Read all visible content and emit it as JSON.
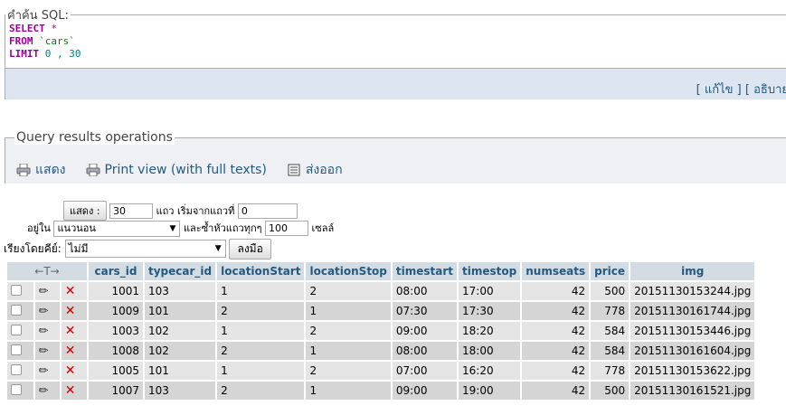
{
  "sql_section": {
    "legend": "คำค้น SQL:",
    "line1_kw": "SELECT",
    "line1_rest": " *",
    "line2_kw": "FROM",
    "line2_str": " `cars`",
    "line3_kw": "LIMIT",
    "line3_num": " 0 , 30",
    "link_edit": "แก้ไข",
    "link_explain": "อธิบาย"
  },
  "qro": {
    "legend": "Query results operations",
    "print": "แสดง",
    "print_full": "Print view (with full texts)",
    "export": "ส่งออก"
  },
  "navigation": {
    "show_button": "แสดง :",
    "rows_value": "30",
    "rows_label": "แถว เริ่มจากแถวที่",
    "start_value": "0",
    "mode_label": "อยู่ใน",
    "mode_value": "แนวนอน",
    "repeat_label": "และซ้ำหัวแถวทุกๆ",
    "repeat_value": "100",
    "cells_label": "เซลล์",
    "sort_label": "เรียงโดยคีย์:",
    "sort_value": "ไม่มี",
    "go_button": "ลงมือ"
  },
  "table": {
    "arrows": "←T→",
    "columns": [
      "cars_id",
      "typecar_id",
      "locationStart",
      "locationStop",
      "timestart",
      "timestop",
      "numseats",
      "price",
      "img"
    ],
    "rows": [
      [
        "1001",
        "103",
        "1",
        "2",
        "08:00",
        "17:00",
        "42",
        "500",
        "20151130153244.jpg"
      ],
      [
        "1009",
        "101",
        "2",
        "1",
        "07:30",
        "17:30",
        "42",
        "778",
        "20151130161744.jpg"
      ],
      [
        "1003",
        "102",
        "1",
        "2",
        "09:00",
        "18:20",
        "42",
        "584",
        "20151130153446.jpg"
      ],
      [
        "1008",
        "102",
        "2",
        "1",
        "08:00",
        "18:00",
        "42",
        "584",
        "20151130161604.jpg"
      ],
      [
        "1005",
        "101",
        "1",
        "2",
        "07:00",
        "16:20",
        "42",
        "778",
        "20151130153622.jpg"
      ],
      [
        "1007",
        "103",
        "2",
        "1",
        "09:00",
        "19:00",
        "42",
        "500",
        "20151130161521.jpg"
      ]
    ]
  },
  "colors": {
    "link": "#235a81",
    "header_bg": "#d3dce3",
    "sql_keyword": "#990099",
    "delete": "#cc0000"
  }
}
